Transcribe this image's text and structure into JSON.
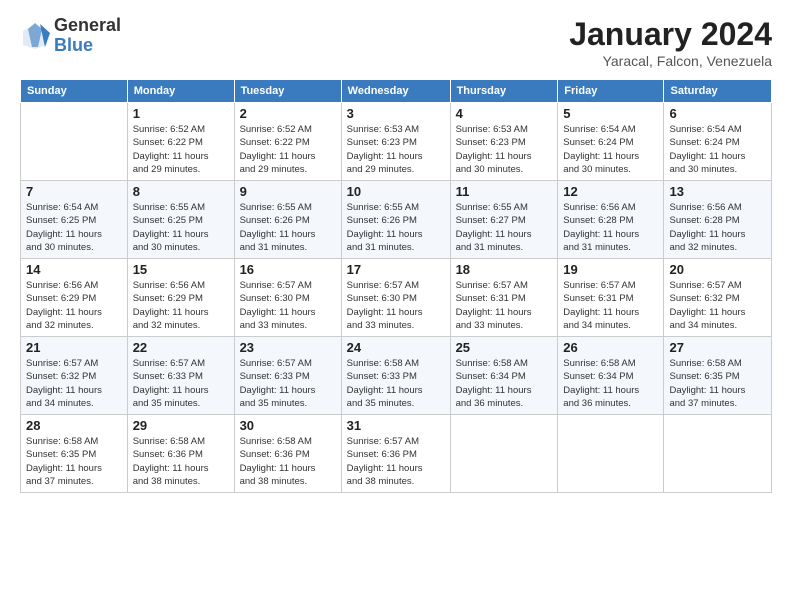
{
  "logo": {
    "general": "General",
    "blue": "Blue"
  },
  "title": "January 2024",
  "subtitle": "Yaracal, Falcon, Venezuela",
  "headers": [
    "Sunday",
    "Monday",
    "Tuesday",
    "Wednesday",
    "Thursday",
    "Friday",
    "Saturday"
  ],
  "weeks": [
    [
      {
        "day": "",
        "text": ""
      },
      {
        "day": "1",
        "text": "Sunrise: 6:52 AM\nSunset: 6:22 PM\nDaylight: 11 hours\nand 29 minutes."
      },
      {
        "day": "2",
        "text": "Sunrise: 6:52 AM\nSunset: 6:22 PM\nDaylight: 11 hours\nand 29 minutes."
      },
      {
        "day": "3",
        "text": "Sunrise: 6:53 AM\nSunset: 6:23 PM\nDaylight: 11 hours\nand 29 minutes."
      },
      {
        "day": "4",
        "text": "Sunrise: 6:53 AM\nSunset: 6:23 PM\nDaylight: 11 hours\nand 30 minutes."
      },
      {
        "day": "5",
        "text": "Sunrise: 6:54 AM\nSunset: 6:24 PM\nDaylight: 11 hours\nand 30 minutes."
      },
      {
        "day": "6",
        "text": "Sunrise: 6:54 AM\nSunset: 6:24 PM\nDaylight: 11 hours\nand 30 minutes."
      }
    ],
    [
      {
        "day": "7",
        "text": "Sunrise: 6:54 AM\nSunset: 6:25 PM\nDaylight: 11 hours\nand 30 minutes."
      },
      {
        "day": "8",
        "text": "Sunrise: 6:55 AM\nSunset: 6:25 PM\nDaylight: 11 hours\nand 30 minutes."
      },
      {
        "day": "9",
        "text": "Sunrise: 6:55 AM\nSunset: 6:26 PM\nDaylight: 11 hours\nand 31 minutes."
      },
      {
        "day": "10",
        "text": "Sunrise: 6:55 AM\nSunset: 6:26 PM\nDaylight: 11 hours\nand 31 minutes."
      },
      {
        "day": "11",
        "text": "Sunrise: 6:55 AM\nSunset: 6:27 PM\nDaylight: 11 hours\nand 31 minutes."
      },
      {
        "day": "12",
        "text": "Sunrise: 6:56 AM\nSunset: 6:28 PM\nDaylight: 11 hours\nand 31 minutes."
      },
      {
        "day": "13",
        "text": "Sunrise: 6:56 AM\nSunset: 6:28 PM\nDaylight: 11 hours\nand 32 minutes."
      }
    ],
    [
      {
        "day": "14",
        "text": "Sunrise: 6:56 AM\nSunset: 6:29 PM\nDaylight: 11 hours\nand 32 minutes."
      },
      {
        "day": "15",
        "text": "Sunrise: 6:56 AM\nSunset: 6:29 PM\nDaylight: 11 hours\nand 32 minutes."
      },
      {
        "day": "16",
        "text": "Sunrise: 6:57 AM\nSunset: 6:30 PM\nDaylight: 11 hours\nand 33 minutes."
      },
      {
        "day": "17",
        "text": "Sunrise: 6:57 AM\nSunset: 6:30 PM\nDaylight: 11 hours\nand 33 minutes."
      },
      {
        "day": "18",
        "text": "Sunrise: 6:57 AM\nSunset: 6:31 PM\nDaylight: 11 hours\nand 33 minutes."
      },
      {
        "day": "19",
        "text": "Sunrise: 6:57 AM\nSunset: 6:31 PM\nDaylight: 11 hours\nand 34 minutes."
      },
      {
        "day": "20",
        "text": "Sunrise: 6:57 AM\nSunset: 6:32 PM\nDaylight: 11 hours\nand 34 minutes."
      }
    ],
    [
      {
        "day": "21",
        "text": "Sunrise: 6:57 AM\nSunset: 6:32 PM\nDaylight: 11 hours\nand 34 minutes."
      },
      {
        "day": "22",
        "text": "Sunrise: 6:57 AM\nSunset: 6:33 PM\nDaylight: 11 hours\nand 35 minutes."
      },
      {
        "day": "23",
        "text": "Sunrise: 6:57 AM\nSunset: 6:33 PM\nDaylight: 11 hours\nand 35 minutes."
      },
      {
        "day": "24",
        "text": "Sunrise: 6:58 AM\nSunset: 6:33 PM\nDaylight: 11 hours\nand 35 minutes."
      },
      {
        "day": "25",
        "text": "Sunrise: 6:58 AM\nSunset: 6:34 PM\nDaylight: 11 hours\nand 36 minutes."
      },
      {
        "day": "26",
        "text": "Sunrise: 6:58 AM\nSunset: 6:34 PM\nDaylight: 11 hours\nand 36 minutes."
      },
      {
        "day": "27",
        "text": "Sunrise: 6:58 AM\nSunset: 6:35 PM\nDaylight: 11 hours\nand 37 minutes."
      }
    ],
    [
      {
        "day": "28",
        "text": "Sunrise: 6:58 AM\nSunset: 6:35 PM\nDaylight: 11 hours\nand 37 minutes."
      },
      {
        "day": "29",
        "text": "Sunrise: 6:58 AM\nSunset: 6:36 PM\nDaylight: 11 hours\nand 38 minutes."
      },
      {
        "day": "30",
        "text": "Sunrise: 6:58 AM\nSunset: 6:36 PM\nDaylight: 11 hours\nand 38 minutes."
      },
      {
        "day": "31",
        "text": "Sunrise: 6:57 AM\nSunset: 6:36 PM\nDaylight: 11 hours\nand 38 minutes."
      },
      {
        "day": "",
        "text": ""
      },
      {
        "day": "",
        "text": ""
      },
      {
        "day": "",
        "text": ""
      }
    ]
  ]
}
